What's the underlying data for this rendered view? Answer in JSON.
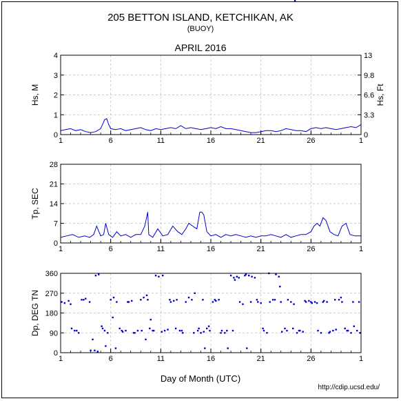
{
  "header": {
    "title": "205 BETTON ISLAND, KETCHIKAN, AK",
    "subtitle": "(BUOY)",
    "period": "APRIL 2016"
  },
  "footer": {
    "xlabel": "Day of Month (UTC)",
    "credit": "http://cdip.ucsd.edu/"
  },
  "colors": {
    "series": "#0000cc",
    "grid": "#bbbbbb",
    "axis": "#000000"
  },
  "chart_data": [
    {
      "type": "line",
      "ylabel": "Hs, M",
      "y2label": "Hs, Ft",
      "xlim": [
        1,
        31
      ],
      "ylim": [
        0,
        4
      ],
      "xticks": [
        "1",
        "6",
        "11",
        "16",
        "21",
        "26",
        "1"
      ],
      "yticks": [
        "0",
        "1",
        "2",
        "3",
        "4"
      ],
      "y2ticks": [
        "0",
        "3.3",
        "6.6",
        "9.8",
        "13"
      ],
      "grid": true,
      "x": [
        1,
        1.5,
        2,
        2.5,
        3,
        3.5,
        4,
        4.5,
        5,
        5.4,
        5.6,
        5.8,
        6,
        6.5,
        7,
        7.5,
        8,
        8.5,
        9,
        9.5,
        10,
        10.5,
        11,
        11.5,
        12,
        12.5,
        13,
        13.5,
        14,
        14.5,
        15,
        15.5,
        16,
        16.5,
        17,
        17.5,
        18,
        18.5,
        19,
        19.5,
        20,
        20.5,
        21,
        21.5,
        22,
        22.5,
        23,
        23.5,
        24,
        24.5,
        25,
        25.5,
        26,
        26.5,
        27,
        27.5,
        28,
        28.5,
        29,
        29.5,
        30,
        30.5,
        31
      ],
      "values": [
        0.2,
        0.25,
        0.3,
        0.2,
        0.25,
        0.15,
        0.1,
        0.15,
        0.3,
        0.75,
        0.8,
        0.5,
        0.3,
        0.25,
        0.3,
        0.2,
        0.25,
        0.3,
        0.35,
        0.25,
        0.2,
        0.3,
        0.25,
        0.3,
        0.35,
        0.3,
        0.45,
        0.3,
        0.35,
        0.3,
        0.25,
        0.3,
        0.35,
        0.3,
        0.4,
        0.3,
        0.3,
        0.25,
        0.2,
        0.15,
        0.1,
        0.1,
        0.15,
        0.2,
        0.2,
        0.15,
        0.2,
        0.3,
        0.25,
        0.2,
        0.2,
        0.15,
        0.3,
        0.35,
        0.3,
        0.35,
        0.3,
        0.25,
        0.3,
        0.35,
        0.4,
        0.35,
        0.5
      ]
    },
    {
      "type": "line",
      "ylabel": "Tp, SEC",
      "xlim": [
        1,
        31
      ],
      "ylim": [
        0,
        28
      ],
      "xticks": [
        "1",
        "6",
        "11",
        "16",
        "21",
        "26",
        "1"
      ],
      "yticks": [
        "0",
        "7",
        "14",
        "21",
        "28"
      ],
      "grid": true,
      "x": [
        1,
        1.6,
        2.2,
        2.8,
        3.4,
        3.9,
        4.3,
        4.6,
        5,
        5.3,
        5.5,
        5.8,
        6.2,
        6.6,
        7,
        7.5,
        8,
        8.5,
        9,
        9.4,
        9.7,
        9.8,
        10.2,
        10.7,
        11.2,
        11.7,
        12.2,
        12.7,
        13.1,
        13.5,
        13.8,
        14.2,
        14.6,
        14.9,
        15.1,
        15.3,
        15.6,
        16,
        16.5,
        17,
        17.5,
        18,
        18.5,
        19,
        19.5,
        20,
        20.5,
        21,
        21.5,
        22,
        22.5,
        23,
        23.5,
        24,
        24.5,
        25,
        25.5,
        26,
        26.3,
        26.6,
        26.9,
        27.2,
        27.5,
        27.9,
        28.3,
        28.7,
        29.1,
        29.5,
        29.9,
        30.4,
        31
      ],
      "values": [
        2,
        2.5,
        3,
        2,
        2.5,
        2,
        3,
        6,
        2.5,
        3,
        7,
        3,
        2,
        4,
        2.5,
        3,
        2,
        3,
        3,
        6,
        11,
        3,
        2,
        5,
        2.5,
        3,
        6,
        4,
        3,
        5,
        7,
        6,
        5,
        11,
        11,
        10,
        4,
        2.5,
        3,
        2,
        3,
        2.5,
        3,
        2.5,
        2,
        2.5,
        2,
        2.5,
        2.5,
        3,
        2.5,
        2,
        3,
        2,
        2.5,
        3,
        3,
        4,
        6,
        7,
        6,
        9,
        8,
        4,
        3,
        2.5,
        6,
        7,
        3,
        2.5,
        2.5
      ]
    },
    {
      "type": "scatter",
      "ylabel": "Dp, DEG TN",
      "xlim": [
        1,
        31
      ],
      "ylim": [
        0,
        360
      ],
      "xticks": [
        "1",
        "6",
        "11",
        "16",
        "21",
        "26",
        "1"
      ],
      "yticks": [
        "0",
        "90",
        "180",
        "270",
        "360"
      ],
      "grid": true,
      "x": [
        1.1,
        1.4,
        1.8,
        2.1,
        2.4,
        2.8,
        3.1,
        3.5,
        3.9,
        4.2,
        4.5,
        4.8,
        5.1,
        5.4,
        5.7,
        6.0,
        6.3,
        6.6,
        6.9,
        7.2,
        7.5,
        7.8,
        8.1,
        8.4,
        8.7,
        9.0,
        9.3,
        9.6,
        9.9,
        10.2,
        10.5,
        10.8,
        11.1,
        11.4,
        11.7,
        12.0,
        12.3,
        12.6,
        12.9,
        13.2,
        13.5,
        13.8,
        14.1,
        14.4,
        14.7,
        15.0,
        15.3,
        15.6,
        15.9,
        16.2,
        16.5,
        16.8,
        17.1,
        17.4,
        17.7,
        18.0,
        18.3,
        18.6,
        18.9,
        19.2,
        19.5,
        19.8,
        20.1,
        20.4,
        20.7,
        21.0,
        21.3,
        21.6,
        21.9,
        22.2,
        22.5,
        22.8,
        23.1,
        23.4,
        23.7,
        24.0,
        24.3,
        24.6,
        24.9,
        25.2,
        25.5,
        25.8,
        26.1,
        26.4,
        26.7,
        27.0,
        27.3,
        27.6,
        27.9,
        28.2,
        28.5,
        28.8,
        29.1,
        29.4,
        29.7,
        30.0,
        30.3,
        30.6,
        30.9,
        2.0,
        2.6,
        3.3,
        4.4,
        4.7,
        5.2,
        6.5,
        7.1,
        7.7,
        8.3,
        9.1,
        9.7,
        10.3,
        11.2,
        11.9,
        12.5,
        13.1,
        14.3,
        15.2,
        15.8,
        16.4,
        17.0,
        17.6,
        18.2,
        18.8,
        19.4,
        20.0,
        20.6,
        21.2,
        21.8,
        22.4,
        23.0,
        23.6,
        24.2,
        24.8,
        25.4,
        26.0,
        26.6,
        27.2,
        27.8,
        28.4,
        29.0,
        29.6,
        30.2,
        30.8,
        4.0,
        5.5,
        6.2,
        9.5,
        10.0,
        14.8,
        15.4,
        18.4,
        19.6,
        22.9,
        24.4
      ],
      "values": [
        230,
        225,
        235,
        110,
        100,
        90,
        240,
        245,
        230,
        60,
        350,
        355,
        120,
        100,
        90,
        240,
        250,
        230,
        110,
        95,
        100,
        230,
        235,
        90,
        100,
        240,
        250,
        260,
        110,
        100,
        350,
        345,
        95,
        100,
        105,
        230,
        235,
        240,
        100,
        90,
        230,
        250,
        240,
        270,
        100,
        90,
        95,
        110,
        100,
        230,
        235,
        240,
        100,
        90,
        20,
        350,
        340,
        345,
        230,
        220,
        355,
        350,
        345,
        340,
        230,
        225,
        100,
        90,
        230,
        240,
        355,
        345,
        95,
        110,
        240,
        230,
        220,
        90,
        100,
        95,
        230,
        235,
        225,
        230,
        100,
        90,
        235,
        230,
        95,
        100,
        105,
        240,
        230,
        110,
        100,
        90,
        120,
        100,
        90,
        220,
        100,
        240,
        10,
        5,
        110,
        20,
        100,
        230,
        90,
        100,
        240,
        100,
        350,
        240,
        110,
        100,
        90,
        240,
        120,
        240,
        90,
        100,
        100,
        340,
        350,
        230,
        240,
        110,
        360,
        240,
        230,
        100,
        110,
        100,
        235,
        230,
        225,
        230,
        90,
        240,
        250,
        100,
        230,
        230,
        10,
        30,
        160,
        60,
        150,
        110,
        20,
        330,
        20,
        300
      ]
    }
  ]
}
